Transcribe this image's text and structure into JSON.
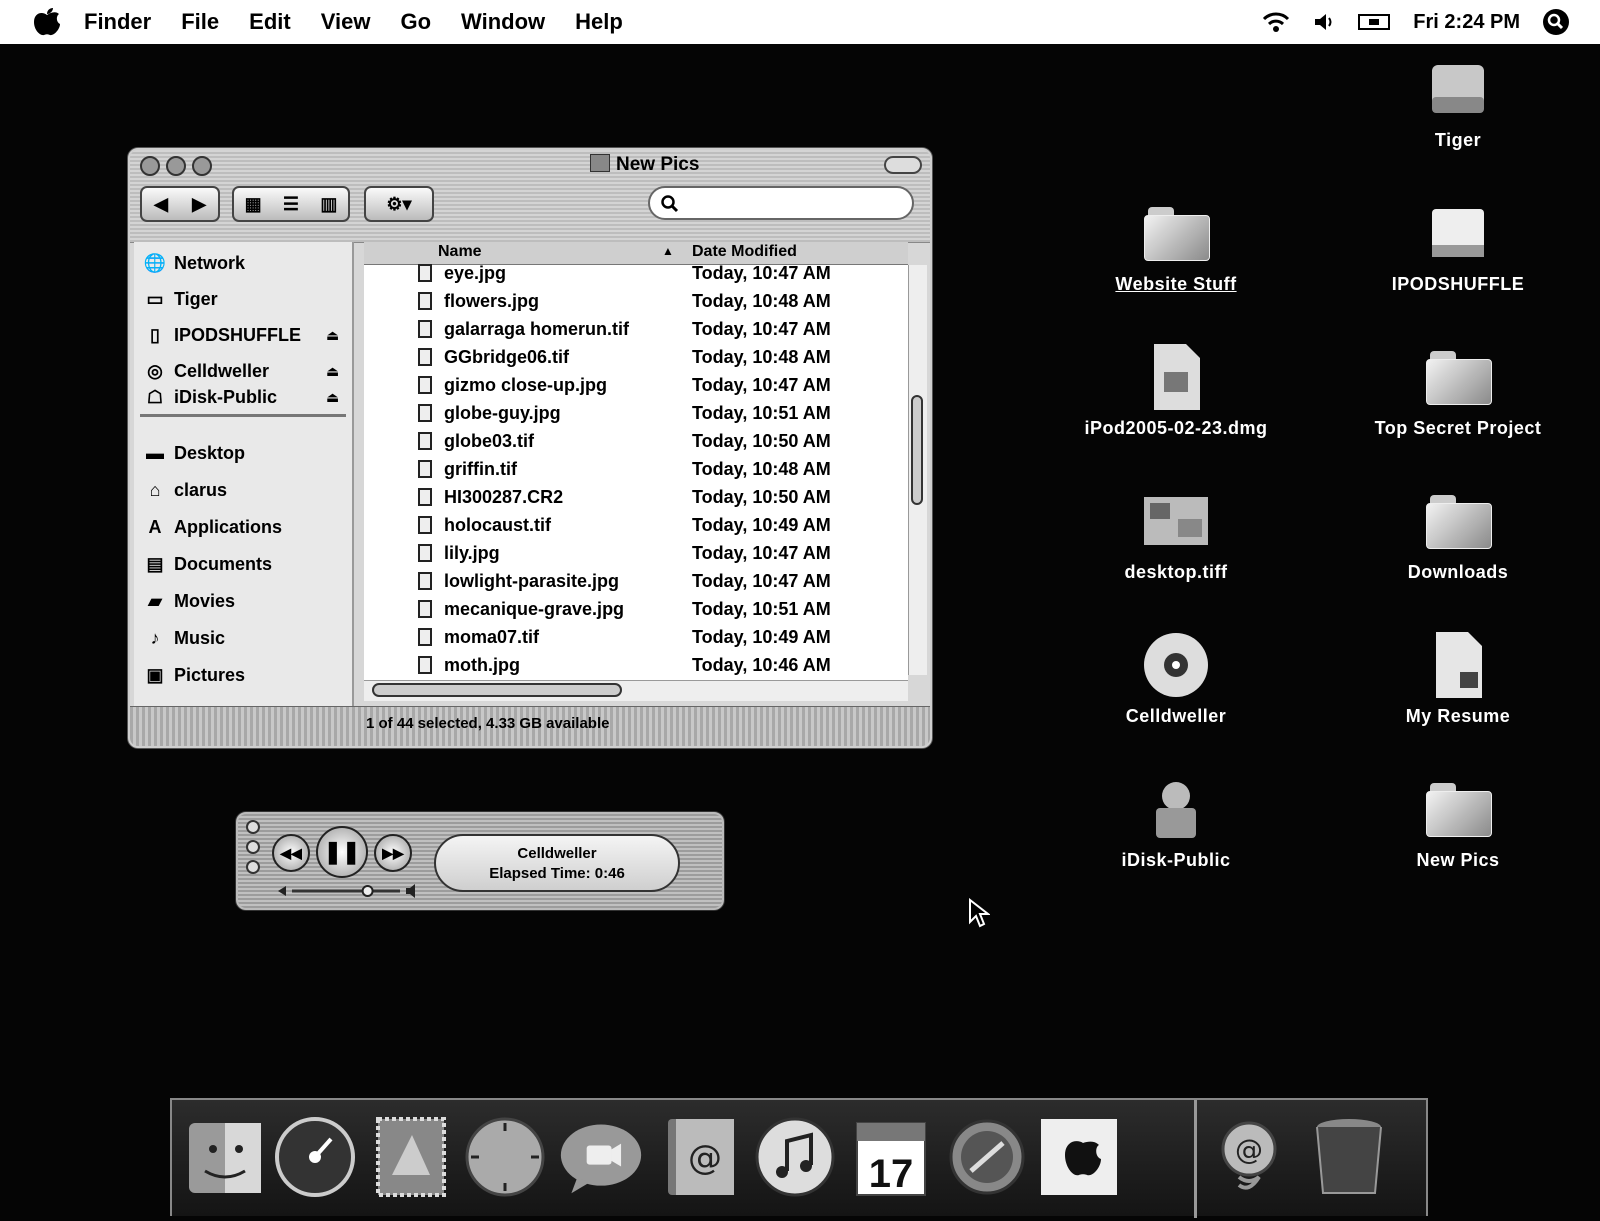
{
  "menubar": {
    "app": "Finder",
    "menus": [
      "File",
      "Edit",
      "View",
      "Go",
      "Window",
      "Help"
    ],
    "clock": "Fri 2:24 PM",
    "status_icons": [
      "wifi-icon",
      "volume-icon",
      "display-icon",
      "spotlight-icon"
    ]
  },
  "finder": {
    "title": "New Pics",
    "search_placeholder": "",
    "sidebar": {
      "devices": [
        {
          "label": "Network",
          "icon": "network-icon",
          "eject": false
        },
        {
          "label": "Tiger",
          "icon": "hard-disk-icon",
          "eject": false
        },
        {
          "label": "IPODSHUFFLE",
          "icon": "ipod-icon",
          "eject": true
        },
        {
          "label": "Celldweller",
          "icon": "cd-icon",
          "eject": true
        },
        {
          "label": "iDisk-Public",
          "icon": "idisk-icon",
          "eject": true
        }
      ],
      "places": [
        {
          "label": "Desktop",
          "icon": "desktop-icon"
        },
        {
          "label": "clarus",
          "icon": "home-icon"
        },
        {
          "label": "Applications",
          "icon": "applications-icon"
        },
        {
          "label": "Documents",
          "icon": "documents-icon"
        },
        {
          "label": "Movies",
          "icon": "movies-icon"
        },
        {
          "label": "Music",
          "icon": "music-icon"
        },
        {
          "label": "Pictures",
          "icon": "pictures-icon"
        }
      ]
    },
    "columns": {
      "name": "Name",
      "date": "Date Modified"
    },
    "files": [
      {
        "name": "eye.jpg",
        "date": "Today, 10:47 AM"
      },
      {
        "name": "flowers.jpg",
        "date": "Today, 10:48 AM"
      },
      {
        "name": "galarraga homerun.tif",
        "date": "Today, 10:47 AM"
      },
      {
        "name": "GGbridge06.tif",
        "date": "Today, 10:48 AM"
      },
      {
        "name": "gizmo close-up.jpg",
        "date": "Today, 10:47 AM"
      },
      {
        "name": "globe-guy.jpg",
        "date": "Today, 10:51 AM"
      },
      {
        "name": "globe03.tif",
        "date": "Today, 10:50 AM"
      },
      {
        "name": "griffin.tif",
        "date": "Today, 10:48 AM"
      },
      {
        "name": "HI300287.CR2",
        "date": "Today, 10:50 AM"
      },
      {
        "name": "holocaust.tif",
        "date": "Today, 10:49 AM"
      },
      {
        "name": "lily.jpg",
        "date": "Today, 10:47 AM"
      },
      {
        "name": "lowlight-parasite.jpg",
        "date": "Today, 10:47 AM"
      },
      {
        "name": "mecanique-grave.jpg",
        "date": "Today, 10:51 AM"
      },
      {
        "name": "moma07.tif",
        "date": "Today, 10:49 AM"
      },
      {
        "name": "moth.jpg",
        "date": "Today, 10:46 AM"
      }
    ],
    "status": "1 of 44 selected, 4.33 GB available"
  },
  "player": {
    "track": "Celldweller",
    "elapsed": "Elapsed Time: 0:46",
    "volume": 0.7
  },
  "desktop": {
    "icons": [
      {
        "label": "Tiger",
        "kind": "hard-disk"
      },
      {
        "label": "Website Stuff",
        "kind": "folder"
      },
      {
        "label": "IPODSHUFFLE",
        "kind": "ipod"
      },
      {
        "label": "iPod2005-02-23.dmg",
        "kind": "disk-image"
      },
      {
        "label": "Top Secret Project",
        "kind": "folder"
      },
      {
        "label": "desktop.tiff",
        "kind": "image-file"
      },
      {
        "label": "Downloads",
        "kind": "folder"
      },
      {
        "label": "Celldweller",
        "kind": "cd"
      },
      {
        "label": "My Resume",
        "kind": "document"
      },
      {
        "label": "iDisk-Public",
        "kind": "idisk"
      },
      {
        "label": "New Pics",
        "kind": "folder"
      }
    ]
  },
  "dock": {
    "calendar_day": "17",
    "apps": [
      "finder-icon",
      "dashboard-icon",
      "mail-stamp-icon",
      "safari-icon",
      "ichat-icon",
      "address-book-icon",
      "itunes-icon",
      "ical-icon",
      "system-preferences-icon",
      "apple-icon",
      "downloads-stack-icon",
      "trash-icon"
    ]
  }
}
